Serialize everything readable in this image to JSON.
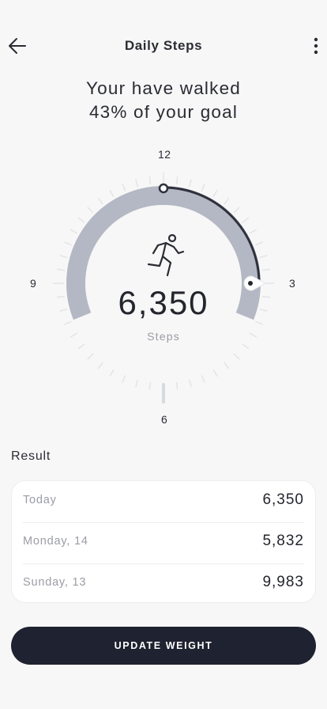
{
  "header": {
    "title": "Daily Steps",
    "back_icon": "arrow-left-icon",
    "menu_icon": "more-vertical-icon"
  },
  "headline": {
    "line1": "Your have walked",
    "line2": "43% of your goal"
  },
  "gauge": {
    "goal_progress_percent": 43,
    "dial_labels": {
      "top": "12",
      "right": "3",
      "bottom": "6",
      "left": "9"
    },
    "steps_value": "6,350",
    "steps_unit": "Steps",
    "center_icon": "running-person-icon",
    "track_color": "#b4b8c4",
    "progress_color": "#2e303b",
    "tick_color": "#e2e3e6"
  },
  "results": {
    "title": "Result",
    "rows": [
      {
        "label": "Today",
        "value": "6,350"
      },
      {
        "label": "Monday, 14",
        "value": "5,832"
      },
      {
        "label": "Sunday, 13",
        "value": "9,983"
      }
    ]
  },
  "actions": {
    "update_label": "UPDATE WEIGHT",
    "button_color": "#1f2230"
  }
}
